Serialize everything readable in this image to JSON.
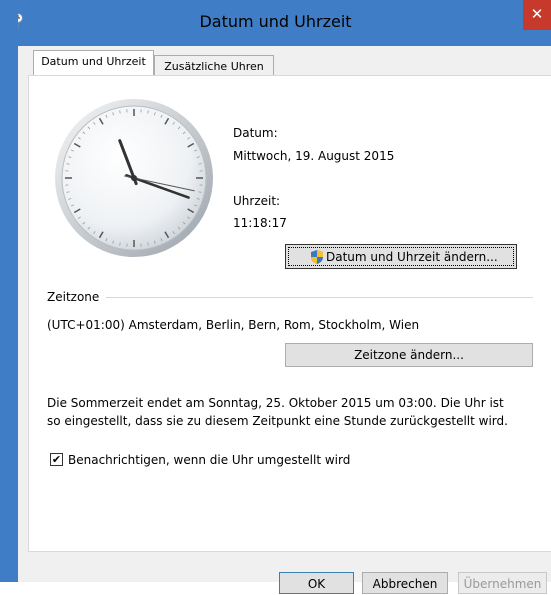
{
  "window": {
    "title": "Datum und Uhrzeit",
    "close_glyph": "✕"
  },
  "tabs": [
    {
      "label": "Datum und Uhrzeit",
      "active": true
    },
    {
      "label": "Zusätzliche Uhren",
      "active": false
    }
  ],
  "clock": {
    "hour": 11,
    "minute": 18,
    "second": 17
  },
  "date": {
    "label": "Datum:",
    "value": "Mittwoch, 19. August 2015"
  },
  "time": {
    "label": "Uhrzeit:",
    "value": "11:18:17"
  },
  "buttons": {
    "change_datetime": "Datum und Uhrzeit ändern...",
    "change_timezone": "Zeitzone ändern...",
    "ok": "OK",
    "cancel": "Abbrechen",
    "apply": "Übernehmen"
  },
  "timezone": {
    "section_label": "Zeitzone",
    "value": "(UTC+01:00) Amsterdam, Berlin, Bern, Rom, Stockholm, Wien"
  },
  "dst": {
    "line1": "Die Sommerzeit endet am Sonntag, 25. Oktober 2015 um 03:00. Die Uhr ist",
    "line2": "so eingestellt, dass sie zu diesem Zeitpunkt eine Stunde zurückgestellt wird."
  },
  "notify": {
    "label": "Benachrichtigen, wenn die Uhr umgestellt wird",
    "checked": true
  },
  "colors": {
    "accent": "#3f7ec6",
    "close": "#c7392b"
  }
}
